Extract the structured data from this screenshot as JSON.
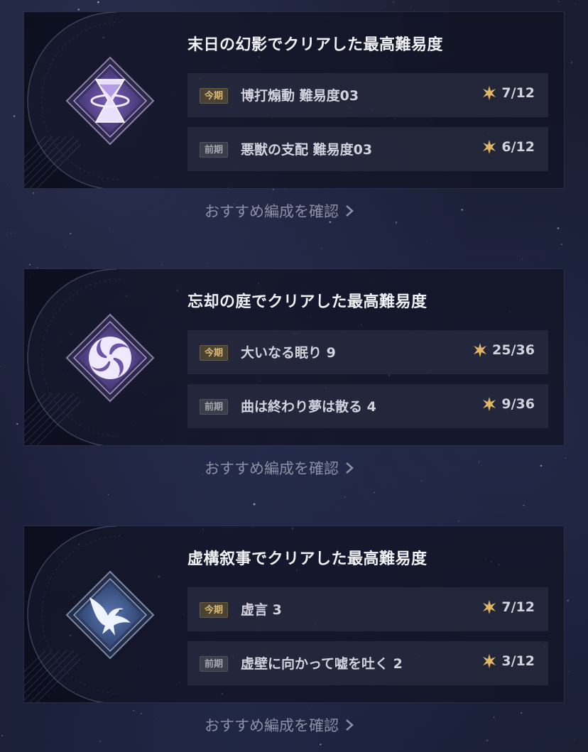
{
  "sections": [
    {
      "icon": "hourglass-icon",
      "title": "末日の幻影でクリアした最高難易度",
      "rows": [
        {
          "tag": "今期",
          "label": "博打煽動 難易度03",
          "score": "7/12"
        },
        {
          "tag": "前期",
          "label": "悪獣の支配 難易度03",
          "score": "6/12"
        }
      ],
      "link": "おすすめ編成を確認"
    },
    {
      "icon": "swirl-icon",
      "title": "忘却の庭でクリアした最高難易度",
      "rows": [
        {
          "tag": "今期",
          "label": "大いなる眠り 9",
          "score": "25/36"
        },
        {
          "tag": "前期",
          "label": "曲は終わり夢は散る 4",
          "score": "9/36"
        }
      ],
      "link": "おすすめ編成を確認"
    },
    {
      "icon": "bird-icon",
      "title": "虚構叙事でクリアした最高難易度",
      "rows": [
        {
          "tag": "今期",
          "label": "虚言 3",
          "score": "7/12"
        },
        {
          "tag": "前期",
          "label": "虚壁に向かって嘘を吐く 2",
          "score": "3/12"
        }
      ],
      "link": "おすすめ編成を確認"
    }
  ],
  "colors": {
    "star": "#e0b865",
    "current_tag": "#d9b978",
    "previous_tag": "#a4a6b2",
    "emblem_purple": "#b49ae0",
    "emblem_blue": "#7a8cc0"
  }
}
